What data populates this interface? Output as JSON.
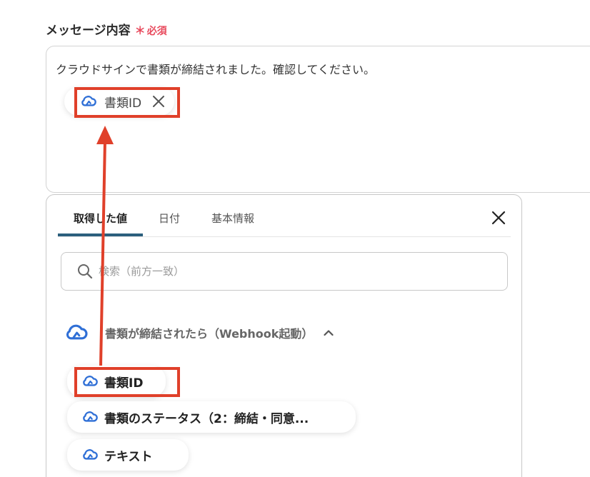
{
  "form": {
    "label": "メッセージ内容",
    "required_mark": "＊",
    "required_text": "必須",
    "message_text": "クラウドサインで書類が締結されました。確認してください。",
    "inserted_variable": {
      "label": "書類ID",
      "icon": "cloudsign-icon"
    }
  },
  "picker": {
    "tabs": [
      {
        "label": "取得した値",
        "active": true
      },
      {
        "label": "日付",
        "active": false
      },
      {
        "label": "基本情報",
        "active": false
      }
    ],
    "search_placeholder": "検索（前方一致）",
    "group": {
      "title": "書類が締結されたら（Webhook起動）",
      "expanded": true,
      "icon": "cloudsign-icon"
    },
    "items": [
      {
        "label": "書類ID",
        "highlighted": true
      },
      {
        "label": "書類のステータス（2：締結・同意..."
      },
      {
        "label": "テキスト"
      }
    ]
  },
  "colors": {
    "required": "#e8495c",
    "highlight": "#e0402a",
    "cloud_icon": "#2f6fd6",
    "active_tab_underline": "#2b5f7d"
  }
}
